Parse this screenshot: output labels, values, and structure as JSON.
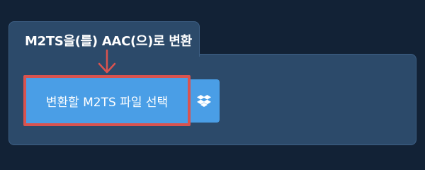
{
  "converter": {
    "tab_title": "M2TS을(를) AAC(으)로 변환",
    "choose_file_label": "변환할 M2TS 파일 선택"
  },
  "icons": {
    "dropbox": "dropbox-icon",
    "arrow": "arrow-down-icon"
  },
  "colors": {
    "background": "#122236",
    "panel": "#2c4a6a",
    "button": "#4a9ee6",
    "highlight": "#d9534f"
  }
}
